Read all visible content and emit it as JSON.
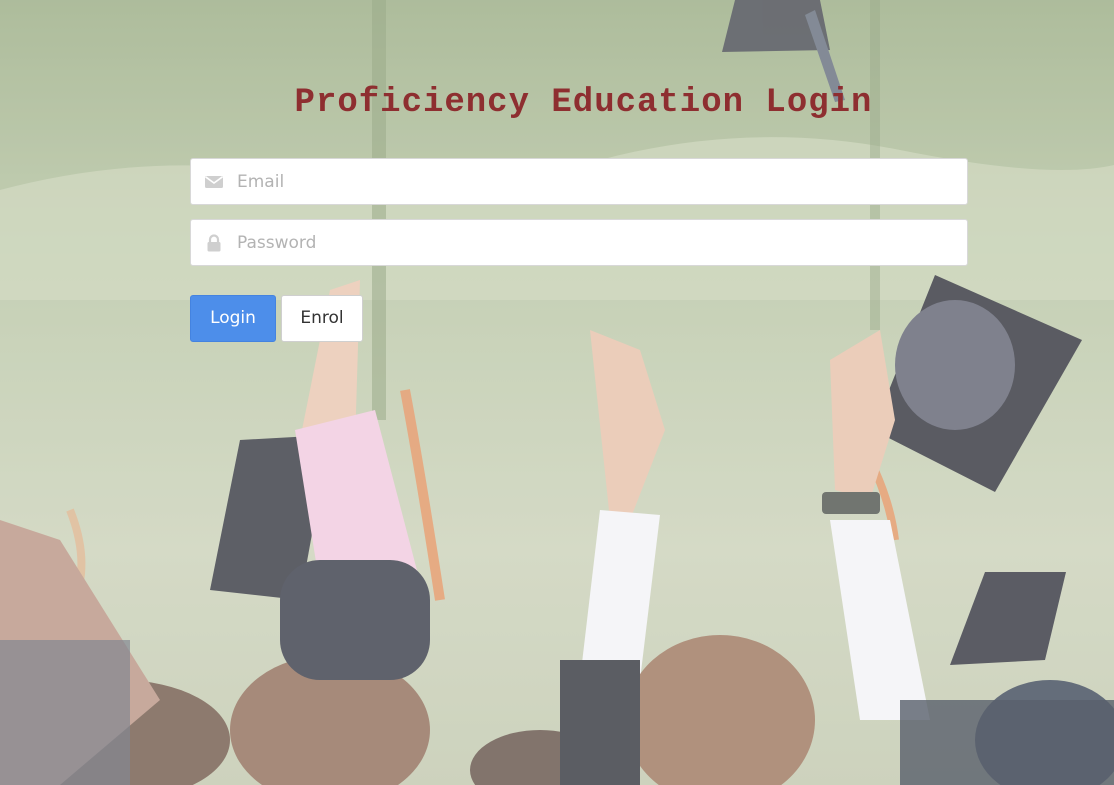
{
  "page": {
    "title": "Proficiency Education Login"
  },
  "form": {
    "email_placeholder": "Email",
    "password_placeholder": "Password",
    "email_icon": "envelope-icon",
    "password_icon": "lock-icon",
    "login_label": "Login",
    "enrol_label": "Enrol"
  },
  "colors": {
    "title": "#8e2e30",
    "login_button": "#4d8eea",
    "background_tint": "#aebd98"
  },
  "background": {
    "description_icon": "graduation-cap-icon"
  }
}
